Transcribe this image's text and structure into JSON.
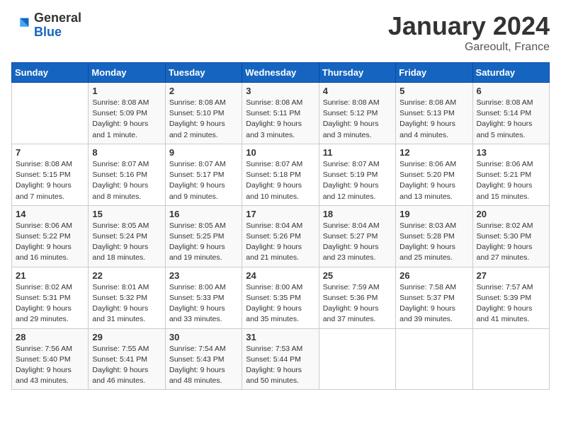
{
  "header": {
    "logo_general": "General",
    "logo_blue": "Blue",
    "title": "January 2024",
    "subtitle": "Gareoult, France"
  },
  "weekdays": [
    "Sunday",
    "Monday",
    "Tuesday",
    "Wednesday",
    "Thursday",
    "Friday",
    "Saturday"
  ],
  "weeks": [
    [
      {
        "day": "",
        "sunrise": "",
        "sunset": "",
        "daylight": ""
      },
      {
        "day": "1",
        "sunrise": "Sunrise: 8:08 AM",
        "sunset": "Sunset: 5:09 PM",
        "daylight": "Daylight: 9 hours and 1 minute."
      },
      {
        "day": "2",
        "sunrise": "Sunrise: 8:08 AM",
        "sunset": "Sunset: 5:10 PM",
        "daylight": "Daylight: 9 hours and 2 minutes."
      },
      {
        "day": "3",
        "sunrise": "Sunrise: 8:08 AM",
        "sunset": "Sunset: 5:11 PM",
        "daylight": "Daylight: 9 hours and 3 minutes."
      },
      {
        "day": "4",
        "sunrise": "Sunrise: 8:08 AM",
        "sunset": "Sunset: 5:12 PM",
        "daylight": "Daylight: 9 hours and 3 minutes."
      },
      {
        "day": "5",
        "sunrise": "Sunrise: 8:08 AM",
        "sunset": "Sunset: 5:13 PM",
        "daylight": "Daylight: 9 hours and 4 minutes."
      },
      {
        "day": "6",
        "sunrise": "Sunrise: 8:08 AM",
        "sunset": "Sunset: 5:14 PM",
        "daylight": "Daylight: 9 hours and 5 minutes."
      }
    ],
    [
      {
        "day": "7",
        "sunrise": "Sunrise: 8:08 AM",
        "sunset": "Sunset: 5:15 PM",
        "daylight": "Daylight: 9 hours and 7 minutes."
      },
      {
        "day": "8",
        "sunrise": "Sunrise: 8:07 AM",
        "sunset": "Sunset: 5:16 PM",
        "daylight": "Daylight: 9 hours and 8 minutes."
      },
      {
        "day": "9",
        "sunrise": "Sunrise: 8:07 AM",
        "sunset": "Sunset: 5:17 PM",
        "daylight": "Daylight: 9 hours and 9 minutes."
      },
      {
        "day": "10",
        "sunrise": "Sunrise: 8:07 AM",
        "sunset": "Sunset: 5:18 PM",
        "daylight": "Daylight: 9 hours and 10 minutes."
      },
      {
        "day": "11",
        "sunrise": "Sunrise: 8:07 AM",
        "sunset": "Sunset: 5:19 PM",
        "daylight": "Daylight: 9 hours and 12 minutes."
      },
      {
        "day": "12",
        "sunrise": "Sunrise: 8:06 AM",
        "sunset": "Sunset: 5:20 PM",
        "daylight": "Daylight: 9 hours and 13 minutes."
      },
      {
        "day": "13",
        "sunrise": "Sunrise: 8:06 AM",
        "sunset": "Sunset: 5:21 PM",
        "daylight": "Daylight: 9 hours and 15 minutes."
      }
    ],
    [
      {
        "day": "14",
        "sunrise": "Sunrise: 8:06 AM",
        "sunset": "Sunset: 5:22 PM",
        "daylight": "Daylight: 9 hours and 16 minutes."
      },
      {
        "day": "15",
        "sunrise": "Sunrise: 8:05 AM",
        "sunset": "Sunset: 5:24 PM",
        "daylight": "Daylight: 9 hours and 18 minutes."
      },
      {
        "day": "16",
        "sunrise": "Sunrise: 8:05 AM",
        "sunset": "Sunset: 5:25 PM",
        "daylight": "Daylight: 9 hours and 19 minutes."
      },
      {
        "day": "17",
        "sunrise": "Sunrise: 8:04 AM",
        "sunset": "Sunset: 5:26 PM",
        "daylight": "Daylight: 9 hours and 21 minutes."
      },
      {
        "day": "18",
        "sunrise": "Sunrise: 8:04 AM",
        "sunset": "Sunset: 5:27 PM",
        "daylight": "Daylight: 9 hours and 23 minutes."
      },
      {
        "day": "19",
        "sunrise": "Sunrise: 8:03 AM",
        "sunset": "Sunset: 5:28 PM",
        "daylight": "Daylight: 9 hours and 25 minutes."
      },
      {
        "day": "20",
        "sunrise": "Sunrise: 8:02 AM",
        "sunset": "Sunset: 5:30 PM",
        "daylight": "Daylight: 9 hours and 27 minutes."
      }
    ],
    [
      {
        "day": "21",
        "sunrise": "Sunrise: 8:02 AM",
        "sunset": "Sunset: 5:31 PM",
        "daylight": "Daylight: 9 hours and 29 minutes."
      },
      {
        "day": "22",
        "sunrise": "Sunrise: 8:01 AM",
        "sunset": "Sunset: 5:32 PM",
        "daylight": "Daylight: 9 hours and 31 minutes."
      },
      {
        "day": "23",
        "sunrise": "Sunrise: 8:00 AM",
        "sunset": "Sunset: 5:33 PM",
        "daylight": "Daylight: 9 hours and 33 minutes."
      },
      {
        "day": "24",
        "sunrise": "Sunrise: 8:00 AM",
        "sunset": "Sunset: 5:35 PM",
        "daylight": "Daylight: 9 hours and 35 minutes."
      },
      {
        "day": "25",
        "sunrise": "Sunrise: 7:59 AM",
        "sunset": "Sunset: 5:36 PM",
        "daylight": "Daylight: 9 hours and 37 minutes."
      },
      {
        "day": "26",
        "sunrise": "Sunrise: 7:58 AM",
        "sunset": "Sunset: 5:37 PM",
        "daylight": "Daylight: 9 hours and 39 minutes."
      },
      {
        "day": "27",
        "sunrise": "Sunrise: 7:57 AM",
        "sunset": "Sunset: 5:39 PM",
        "daylight": "Daylight: 9 hours and 41 minutes."
      }
    ],
    [
      {
        "day": "28",
        "sunrise": "Sunrise: 7:56 AM",
        "sunset": "Sunset: 5:40 PM",
        "daylight": "Daylight: 9 hours and 43 minutes."
      },
      {
        "day": "29",
        "sunrise": "Sunrise: 7:55 AM",
        "sunset": "Sunset: 5:41 PM",
        "daylight": "Daylight: 9 hours and 46 minutes."
      },
      {
        "day": "30",
        "sunrise": "Sunrise: 7:54 AM",
        "sunset": "Sunset: 5:43 PM",
        "daylight": "Daylight: 9 hours and 48 minutes."
      },
      {
        "day": "31",
        "sunrise": "Sunrise: 7:53 AM",
        "sunset": "Sunset: 5:44 PM",
        "daylight": "Daylight: 9 hours and 50 minutes."
      },
      {
        "day": "",
        "sunrise": "",
        "sunset": "",
        "daylight": ""
      },
      {
        "day": "",
        "sunrise": "",
        "sunset": "",
        "daylight": ""
      },
      {
        "day": "",
        "sunrise": "",
        "sunset": "",
        "daylight": ""
      }
    ]
  ]
}
